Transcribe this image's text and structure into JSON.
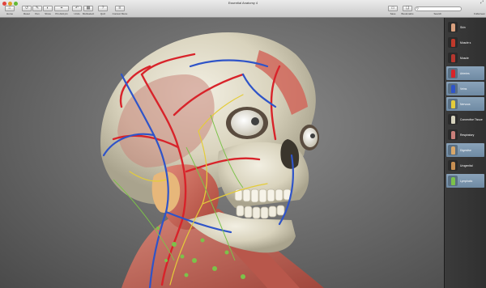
{
  "window": {
    "title": "Essential Anatomy 4"
  },
  "toolbar": {
    "items": [
      {
        "label": "Home",
        "icon": "home-icon"
      },
      {
        "label": "Reset",
        "icon": "reset-icon"
      },
      {
        "label": "Pen",
        "icon": "pen-icon"
      },
      {
        "label": "Show",
        "icon": "show-icon"
      },
      {
        "label": "Pin  Add pin",
        "icon": "pin-icon"
      },
      {
        "label": "Undo",
        "icon": "undo-icon"
      },
      {
        "label": "Multiselect",
        "icon": "multiselect-icon"
      },
      {
        "label": "Quiz",
        "icon": "quiz-icon"
      },
      {
        "label": "Context Menu",
        "icon": "context-menu-icon"
      }
    ],
    "right_items": [
      {
        "label": "Save",
        "icon": "save-icon"
      },
      {
        "label": "Bookmarks",
        "icon": "bookmarks-icon"
      }
    ],
    "search": {
      "placeholder": "",
      "label": "Search"
    },
    "fullscreen": {
      "label": "Fullscreen",
      "icon": "fullscreen-icon"
    }
  },
  "layers": [
    {
      "label": "Skin",
      "active": false,
      "color": "#d9a07e"
    },
    {
      "label": "Muscle s",
      "active": false,
      "color": "#c0392b"
    },
    {
      "label": "Muscle",
      "active": false,
      "color": "#b5372f"
    },
    {
      "label": "Arteries",
      "active": true,
      "color": "#d8232a"
    },
    {
      "label": "Veins",
      "active": true,
      "color": "#2f54c8"
    },
    {
      "label": "Nervous",
      "active": true,
      "color": "#e4cc3a"
    },
    {
      "label": "Connective Tissue",
      "active": false,
      "color": "#d6d2bd"
    },
    {
      "label": "Respiratory",
      "active": false,
      "color": "#c97f7a"
    },
    {
      "label": "Digestive",
      "active": true,
      "color": "#d9a86a"
    },
    {
      "label": "Urogenital",
      "active": false,
      "color": "#c78f52"
    },
    {
      "label": "Lymphatic",
      "active": true,
      "color": "#7cc24a"
    }
  ],
  "colors": {
    "artery": "#d8232a",
    "vein": "#2f54c8",
    "nerve": "#e4cc3a",
    "lymph": "#7cc24a",
    "bone": "#e8e3cf",
    "muscle": "#c8645a",
    "panel_active": "#7d97ae"
  }
}
